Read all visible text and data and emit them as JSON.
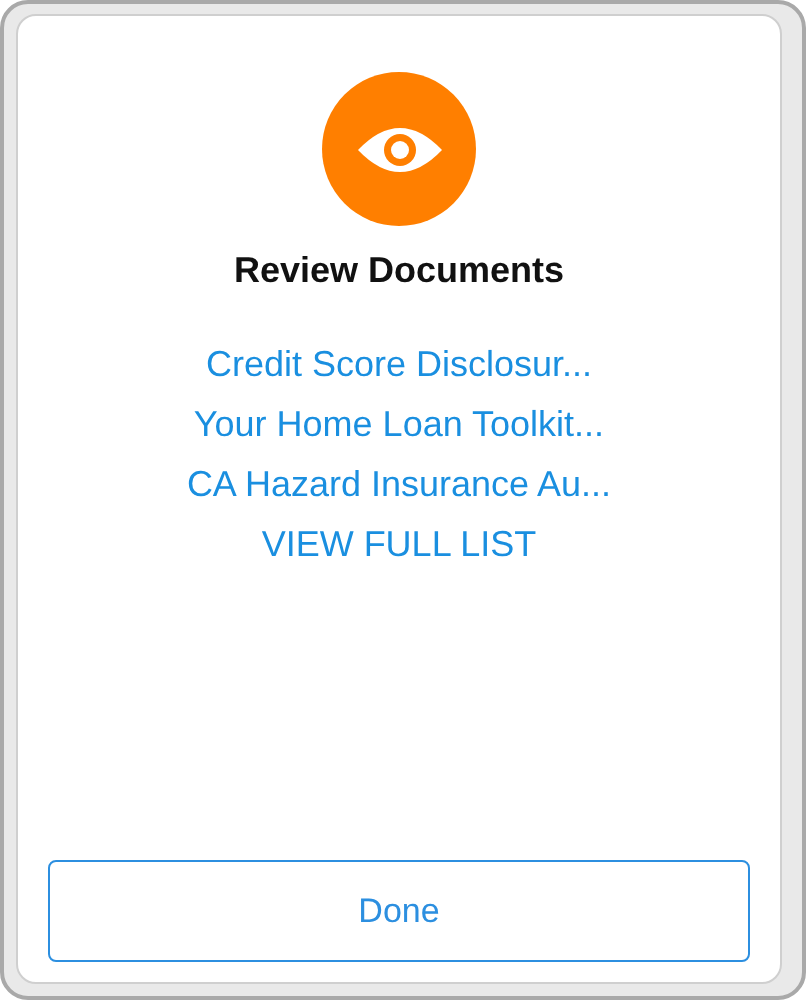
{
  "title": "Review Documents",
  "links": [
    {
      "label": "Credit Score Disclosur..."
    },
    {
      "label": "Your Home Loan Toolkit..."
    },
    {
      "label": "CA Hazard Insurance Au..."
    },
    {
      "label": "VIEW FULL LIST"
    }
  ],
  "button": {
    "label": "Done"
  }
}
